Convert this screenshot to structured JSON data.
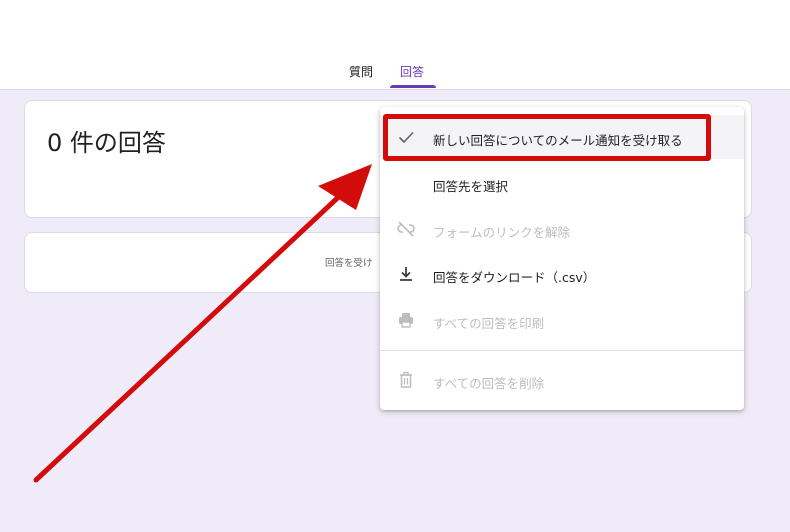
{
  "tabs": [
    {
      "label": "質問"
    },
    {
      "label": "回答"
    }
  ],
  "summary": {
    "count_label": "0 件の回答"
  },
  "accepting": {
    "text": "回答を受け"
  },
  "menu": {
    "items": [
      {
        "label": "新しい回答についてのメール通知を受け取る",
        "icon": "check-icon",
        "enabled": true,
        "checked": true
      },
      {
        "label": "回答先を選択",
        "icon": "",
        "enabled": true
      },
      {
        "label": "フォームのリンクを解除",
        "icon": "unlink-icon",
        "enabled": false
      },
      {
        "label": "回答をダウンロード（.csv）",
        "icon": "download-icon",
        "enabled": true
      },
      {
        "label": "すべての回答を印刷",
        "icon": "print-icon",
        "enabled": false
      },
      {
        "label": "すべての回答を削除",
        "icon": "trash-icon",
        "enabled": false
      }
    ]
  },
  "colors": {
    "accent": "#673ab7",
    "background": "#f0ebf8",
    "highlight": "#d40b0b"
  }
}
